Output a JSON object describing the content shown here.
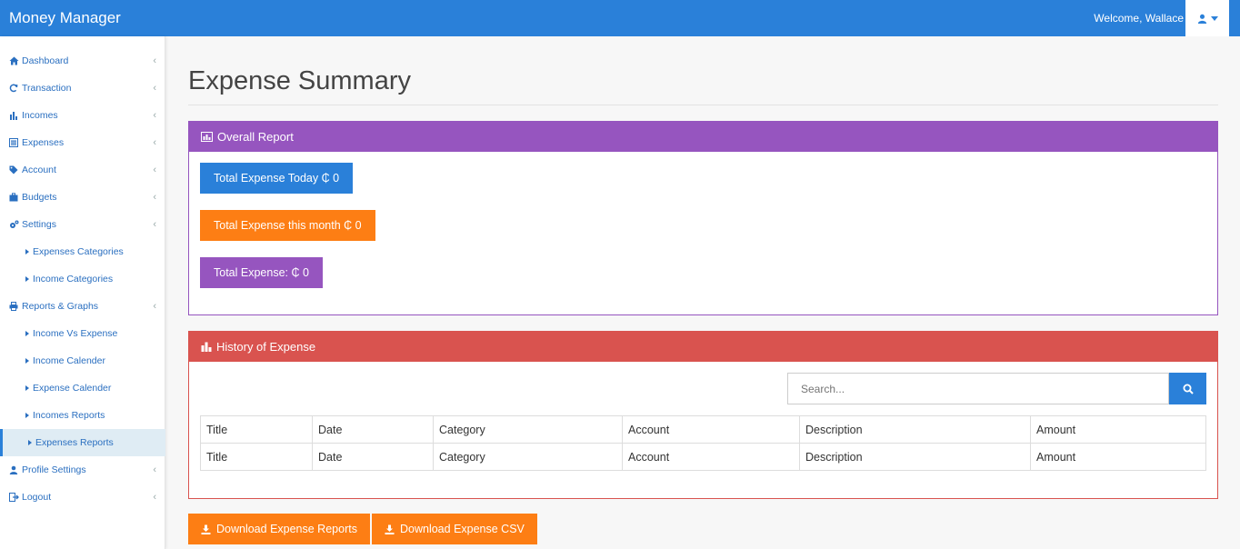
{
  "app": {
    "title": "Money Manager",
    "welcome": "Welcome, Wallace"
  },
  "sidebar": {
    "items": [
      {
        "label": "Dashboard",
        "icon": "home-icon"
      },
      {
        "label": "Transaction",
        "icon": "refresh-icon"
      },
      {
        "label": "Incomes",
        "icon": "bar-chart-icon"
      },
      {
        "label": "Expenses",
        "icon": "list-icon"
      },
      {
        "label": "Account",
        "icon": "tag-icon"
      },
      {
        "label": "Budgets",
        "icon": "briefcase-icon"
      },
      {
        "label": "Settings",
        "icon": "gears-icon"
      },
      {
        "label": "Expenses Categories",
        "sub": true
      },
      {
        "label": "Income Categories",
        "sub": true
      },
      {
        "label": "Reports & Graphs",
        "icon": "print-icon"
      },
      {
        "label": "Income Vs Expense",
        "sub": true
      },
      {
        "label": "Income Calender",
        "sub": true
      },
      {
        "label": "Expense Calender",
        "sub": true
      },
      {
        "label": "Incomes Reports",
        "sub": true
      },
      {
        "label": "Expenses Reports",
        "sub": true,
        "active": true
      },
      {
        "label": "Profile Settings",
        "icon": "user-icon"
      },
      {
        "label": "Logout",
        "icon": "sign-out-icon"
      }
    ]
  },
  "main": {
    "page_title": "Expense Summary",
    "overall": {
      "heading": "Overall Report",
      "today": "Total Expense Today ₵ 0",
      "month": "Total Expense this month ₵ 0",
      "total": "Total Expense: ₵ 0"
    },
    "history": {
      "heading": "History of Expense",
      "search_placeholder": "Search...",
      "columns": [
        "Title",
        "Date",
        "Category",
        "Account",
        "Description",
        "Amount"
      ],
      "rows": [
        [
          "Title",
          "Date",
          "Category",
          "Account",
          "Description",
          "Amount"
        ]
      ]
    },
    "download_reports": "Download Expense Reports",
    "download_csv": "Download Expense CSV"
  },
  "colors": {
    "primary": "#2a80d9",
    "purple": "#9655bf",
    "orange": "#fd7e14",
    "red": "#d9534f"
  }
}
